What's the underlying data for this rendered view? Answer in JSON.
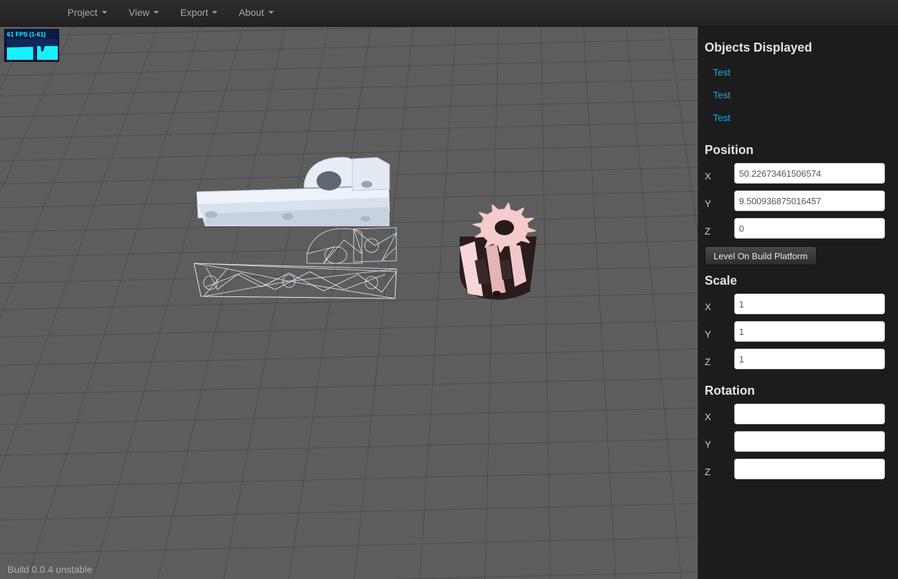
{
  "menu": {
    "items": [
      {
        "label": "Project"
      },
      {
        "label": "View"
      },
      {
        "label": "Export"
      },
      {
        "label": "About"
      }
    ]
  },
  "stats": {
    "fps_label": "61 FPS (1-61)"
  },
  "footer": {
    "build": "Build 0.0.4 unstable"
  },
  "sidebar": {
    "objects_title": "Objects Displayed",
    "objects": [
      {
        "label": "Test"
      },
      {
        "label": "Test"
      },
      {
        "label": "Test"
      }
    ],
    "position": {
      "title": "Position",
      "x_label": "X",
      "x_value": "50.22673461506574",
      "y_label": "Y",
      "y_value": "9.500936875016457",
      "z_label": "Z",
      "z_value": "0"
    },
    "level_button": "Level On Build Platform",
    "scale": {
      "title": "Scale",
      "x_label": "X",
      "x_value": "1",
      "y_label": "Y",
      "y_value": "1",
      "z_label": "Z",
      "z_value": "1"
    },
    "rotation": {
      "title": "Rotation",
      "x_label": "X",
      "x_value": "",
      "y_label": "Y",
      "y_value": "",
      "z_label": "Z",
      "z_value": ""
    }
  },
  "colors": {
    "viewport_bg": "#5d5d5d",
    "grid_line": "#4b4b4b",
    "link": "#1aa6e0",
    "sidebar_bg": "#1c1c1c",
    "gear": "#f3c6c6",
    "bracket": "#dfe8f2"
  }
}
